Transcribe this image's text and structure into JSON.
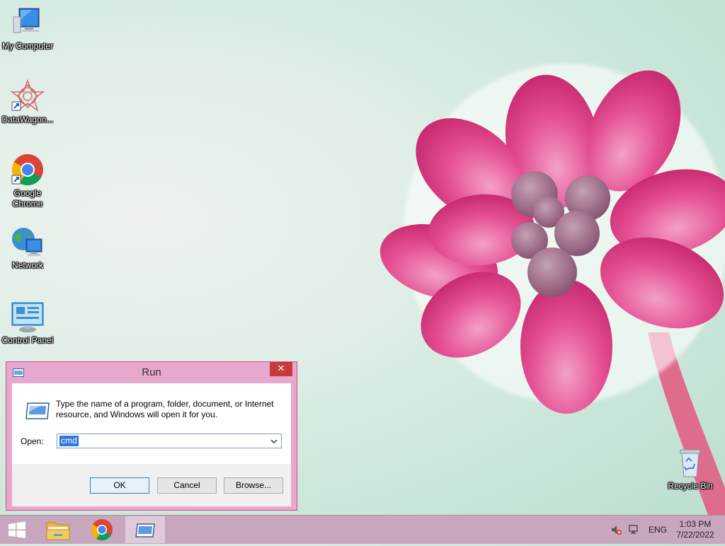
{
  "desktop": {
    "icons": [
      {
        "label": "My Computer"
      },
      {
        "label": "DataWagon..."
      },
      {
        "label": "Google Chrome"
      },
      {
        "label": "Network"
      },
      {
        "label": "Control Panel"
      },
      {
        "label": "Recycle Bin"
      }
    ]
  },
  "run_dialog": {
    "title": "Run",
    "close_glyph": "✕",
    "description": "Type the name of a program, folder, document, or Internet resource, and Windows will open it for you.",
    "open_label": "Open:",
    "open_value": "cmd",
    "buttons": {
      "ok": "OK",
      "cancel": "Cancel",
      "browse": "Browse..."
    }
  },
  "taskbar": {
    "language": "ENG",
    "time": "1:03 PM",
    "date": "7/22/2022"
  },
  "colors": {
    "accent": "#c74d8e",
    "close": "#c7393b",
    "taskbar": "#c8a6bd",
    "selection": "#3377dd"
  }
}
